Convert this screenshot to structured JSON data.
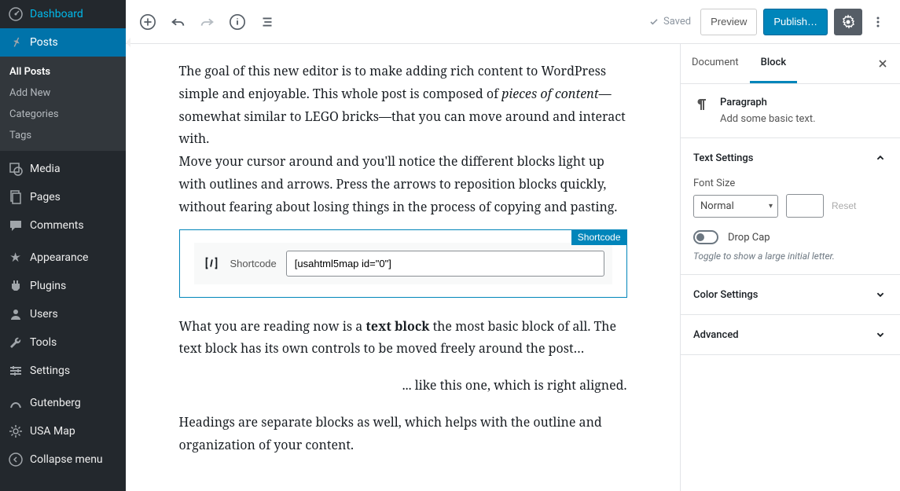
{
  "sidebar": {
    "dashboard": "Dashboard",
    "posts": "Posts",
    "all_posts": "All Posts",
    "add_new": "Add New",
    "categories": "Categories",
    "tags": "Tags",
    "media": "Media",
    "pages": "Pages",
    "comments": "Comments",
    "appearance": "Appearance",
    "plugins": "Plugins",
    "users": "Users",
    "tools": "Tools",
    "settings": "Settings",
    "gutenberg": "Gutenberg",
    "usa_map": "USA Map",
    "collapse": "Collapse menu"
  },
  "topbar": {
    "saved": "Saved",
    "preview": "Preview",
    "publish": "Publish…"
  },
  "content": {
    "p1_a": "The goal of this new editor is to make adding rich content to WordPress simple and enjoyable. This whole post is composed of ",
    "p1_em": "pieces of content",
    "p1_b": "—somewhat similar to LEGO bricks—that you can move around and interact with.",
    "p2": "Move your cursor around and you'll notice the different blocks light up with outlines and arrows. Press the arrows to reposition blocks quickly, without fearing about losing things in the process of copying and pasting.",
    "shortcode_tag": "Shortcode",
    "shortcode_label": "Shortcode",
    "shortcode_value": "[usahtml5map id=\"0\"]",
    "p3_a": "What you are reading now is a ",
    "p3_strong": "text block",
    "p3_b": " the most basic block of all. The text block has its own controls to be moved freely around the post…",
    "p4": "... like this one, which is right aligned.",
    "p5": "Headings are separate blocks as well, which helps with the outline and organization of your content."
  },
  "inspector": {
    "tab_document": "Document",
    "tab_block": "Block",
    "block_name": "Paragraph",
    "block_desc": "Add some basic text.",
    "text_settings": "Text Settings",
    "font_size_label": "Font Size",
    "font_size_value": "Normal",
    "reset": "Reset",
    "drop_cap": "Drop Cap",
    "drop_cap_hint": "Toggle to show a large initial letter.",
    "color_settings": "Color Settings",
    "advanced": "Advanced"
  }
}
